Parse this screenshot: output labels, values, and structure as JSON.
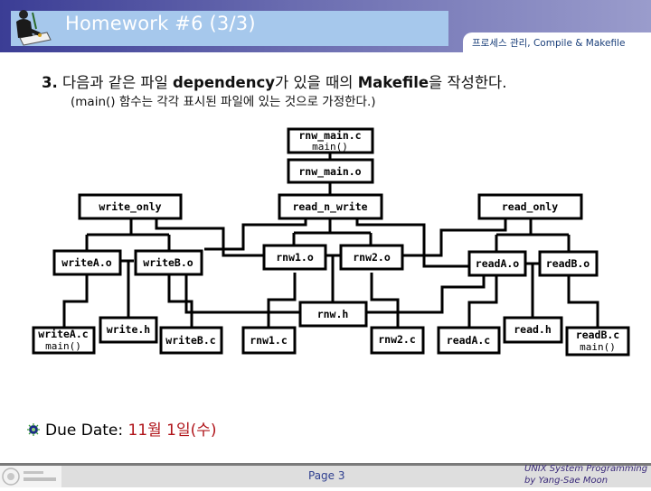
{
  "header": {
    "title": "Homework #6 (3/3)",
    "subtitle": "프로세스 관리, Compile & Makefile",
    "icon": "person-writing-icon"
  },
  "question": {
    "number": "3.",
    "text_before": " 다음과 같은 파일 ",
    "keyword1": "dependency",
    "text_middle": "가 있을 때의 ",
    "keyword2": "Makefile",
    "text_after": "을 작성한다.",
    "note": "(main() 함수는 각각 표시된 파일에 있는 것으로 가정한다.)"
  },
  "diagram": {
    "nodes": {
      "rnw_main_c": {
        "label": "rnw_main.c",
        "sub": "main()"
      },
      "rnw_main_o": {
        "label": "rnw_main.o"
      },
      "write_only": {
        "label": "write_only"
      },
      "read_n_write": {
        "label": "read_n_write"
      },
      "read_only": {
        "label": "read_only"
      },
      "writeA_o": {
        "label": "writeA.o"
      },
      "writeB_o": {
        "label": "writeB.o"
      },
      "rnw1_o": {
        "label": "rnw1.o"
      },
      "rnw2_o": {
        "label": "rnw2.o"
      },
      "readA_o": {
        "label": "readA.o"
      },
      "readB_o": {
        "label": "readB.o"
      },
      "rnw_h": {
        "label": "rnw.h"
      },
      "writeA_c": {
        "label": "writeA.c",
        "sub": "main()"
      },
      "write_h": {
        "label": "write.h"
      },
      "writeB_c": {
        "label": "writeB.c"
      },
      "rnw1_c": {
        "label": "rnw1.c"
      },
      "rnw2_c": {
        "label": "rnw2.c"
      },
      "readA_c": {
        "label": "readA.c"
      },
      "read_h": {
        "label": "read.h"
      },
      "readB_c": {
        "label": "readB.c",
        "sub": "main()"
      }
    }
  },
  "due": {
    "icon": "bullet-gear-icon",
    "label": "Due Date: ",
    "value": "11월 1일(수)"
  },
  "footer": {
    "page": "Page 3",
    "credit_line1": "UNIX System Programming",
    "credit_line2": "by Yang-Sae Moon",
    "logo": "university-logo"
  },
  "colors": {
    "header_dark": "#3b3d95",
    "title_bar": "#a6c8ec",
    "due_value": "#b0141a",
    "subtitle": "#1a3f7a",
    "credit": "#3a2a7a"
  }
}
